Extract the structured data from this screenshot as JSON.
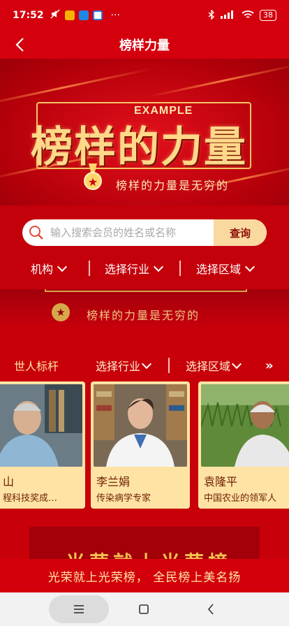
{
  "status_bar": {
    "time": "17:52",
    "dots": "···",
    "battery": "38"
  },
  "nav": {
    "title": "榜样力量"
  },
  "hero": {
    "title": "榜样的力量",
    "example": "EXAMPLE",
    "subtitle": "榜样的力量是无穷的"
  },
  "search": {
    "placeholder": "输入搜索会员的姓名或名称",
    "button_label": "查询"
  },
  "filters": [
    {
      "label": "机构"
    },
    {
      "label": "选择行业"
    },
    {
      "label": "选择区域"
    }
  ],
  "banner2": {
    "subtitle": "榜样的力量是无穷的"
  },
  "section": {
    "title": "世人标杆",
    "filter_industry": "选择行业",
    "filter_region": "选择区域",
    "more": "»"
  },
  "cards": [
    {
      "name": "山",
      "desc": "程科技奖成…"
    },
    {
      "name": "李兰娟",
      "desc": "传染病学专家"
    },
    {
      "name": "袁隆平",
      "desc": "中国农业的领军人"
    }
  ],
  "bottom_banner": {
    "text": "光荣就上光荣榜"
  },
  "slogan": "光荣就上光荣榜，  全民榜上美名扬",
  "colors": {
    "primary_red": "#d5000d",
    "gold": "#ffd889",
    "card_bg": "#ffe3a4",
    "search_btn": "#f9d9a0"
  }
}
